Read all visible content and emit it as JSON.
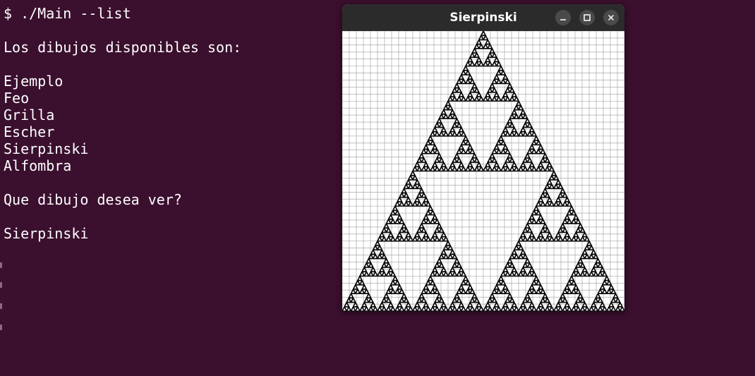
{
  "terminal": {
    "lines": [
      "$ ./Main --list",
      "",
      "Los dibujos disponibles son:",
      "",
      "Ejemplo",
      "Feo",
      "Grilla",
      "Escher",
      "Sierpinski",
      "Alfombra",
      "",
      "Que dibujo desea ver?",
      "",
      "Sierpinski"
    ],
    "background": "#3b0f2e",
    "foreground": "#ffffff"
  },
  "window": {
    "title": "Sierpinski",
    "titlebar_color": "#2b2b2b",
    "buttons": [
      {
        "name": "minimize",
        "icon": "minimize-icon"
      },
      {
        "name": "maximize",
        "icon": "maximize-icon"
      },
      {
        "name": "close",
        "icon": "close-icon"
      }
    ]
  },
  "drawing": {
    "name": "Sierpinski",
    "grid_divisions": 40,
    "recursion_depth": 6,
    "grid_color": "#9a9a9a",
    "fill_color": "#000000",
    "background": "#ffffff"
  }
}
